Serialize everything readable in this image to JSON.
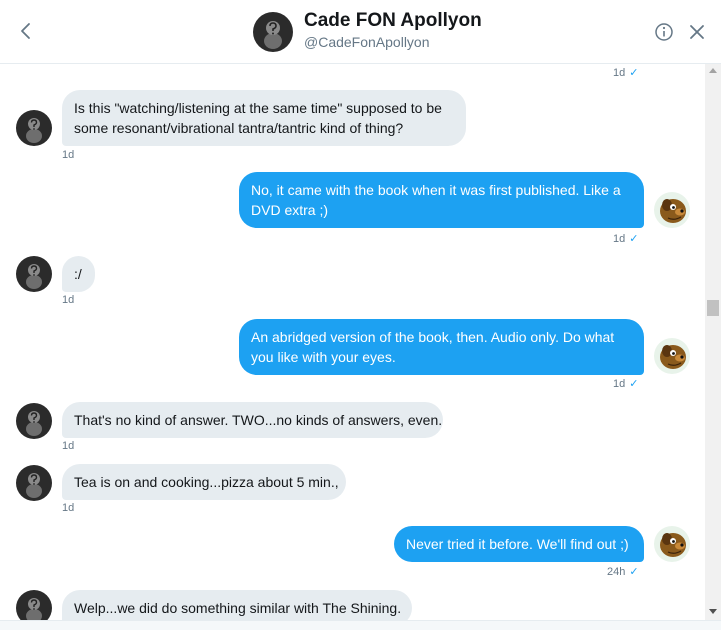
{
  "header": {
    "name": "Cade FON Apollyon",
    "handle": "@CadeFonApollyon"
  },
  "icons": {
    "back": "chevron-left-icon",
    "info": "info-circle-icon",
    "close": "close-icon"
  },
  "colors": {
    "accent": "#1da1f2",
    "incoming_bubble": "#e6ecf0",
    "meta_text": "#657786"
  },
  "messages": [
    {
      "direction": "out",
      "text": "",
      "meta": "1d",
      "read": true
    },
    {
      "direction": "in",
      "lines": [
        "Is this \"watching/listening at the same time\" supposed to be",
        "some resonant/vibrational tantra/tantric kind of thing?"
      ],
      "meta": "1d"
    },
    {
      "direction": "out",
      "lines": [
        "No, it came with the book when it was first published. Like a",
        "DVD extra ;)"
      ],
      "meta": "1d",
      "read": true
    },
    {
      "direction": "in",
      "lines": [
        ":/"
      ],
      "meta": "1d"
    },
    {
      "direction": "out",
      "lines": [
        "An abridged version of the book, then. Audio only. Do what",
        "you like with your eyes."
      ],
      "meta": "1d",
      "read": true
    },
    {
      "direction": "in",
      "lines": [
        "That's no kind of answer. TWO...no kinds of answers, even."
      ],
      "meta": "1d"
    },
    {
      "direction": "in",
      "lines": [
        "Tea is on and cooking...pizza about 5 min.,"
      ],
      "meta": "1d"
    },
    {
      "direction": "out",
      "lines": [
        "Never tried it before. We'll find out ;)"
      ],
      "meta": "24h",
      "read": true
    },
    {
      "direction": "in",
      "lines": [
        "Welp...we did do something similar with The Shining."
      ],
      "meta": ""
    }
  ]
}
